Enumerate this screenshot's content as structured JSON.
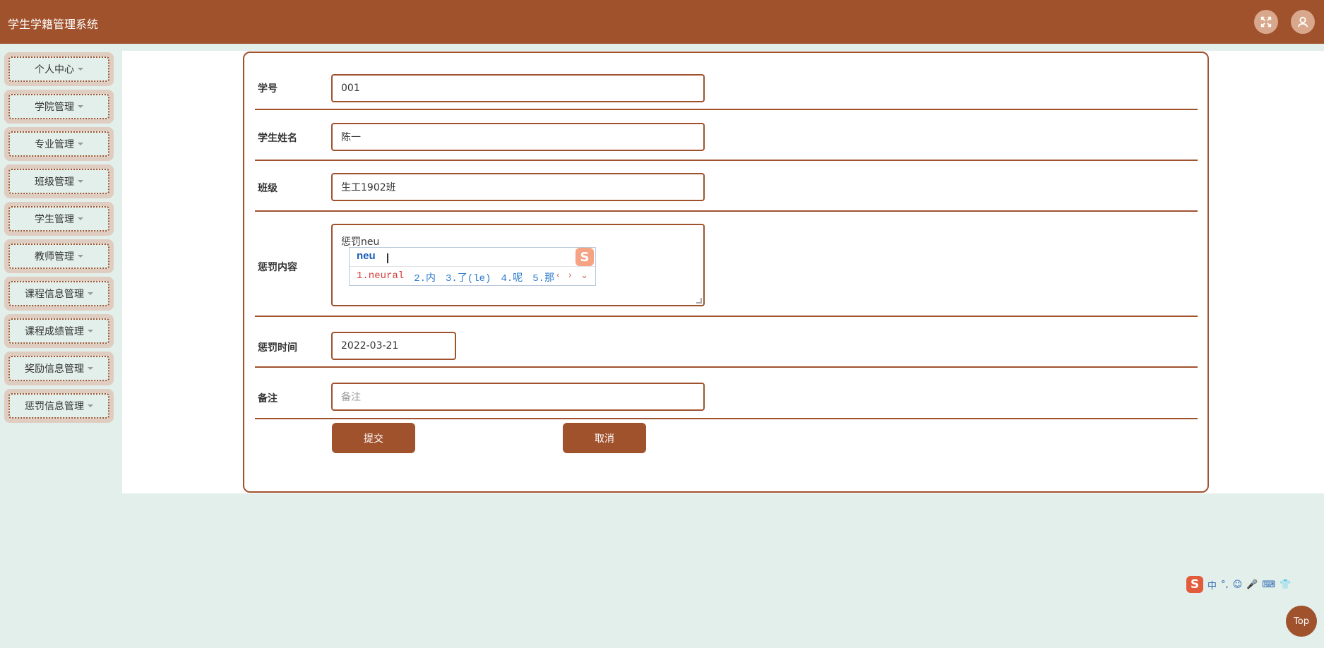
{
  "app": {
    "title": "学生学籍管理系统"
  },
  "header": {
    "fullscreen_icon": "fullscreen-icon",
    "user_icon": "user-icon"
  },
  "sidebar": {
    "items": [
      {
        "label": "个人中心"
      },
      {
        "label": "学院管理"
      },
      {
        "label": "专业管理"
      },
      {
        "label": "班级管理"
      },
      {
        "label": "学生管理"
      },
      {
        "label": "教师管理"
      },
      {
        "label": "课程信息管理"
      },
      {
        "label": "课程成绩管理"
      },
      {
        "label": "奖励信息管理"
      },
      {
        "label": "惩罚信息管理"
      }
    ]
  },
  "form": {
    "student_id": {
      "label": "学号",
      "value": "001"
    },
    "student_name": {
      "label": "学生姓名",
      "value": "陈一"
    },
    "class": {
      "label": "班级",
      "value": "生工1902班"
    },
    "punishment_content": {
      "label": "惩罚内容",
      "value": "惩罚neu"
    },
    "punishment_time": {
      "label": "惩罚时间",
      "value": "2022-03-21"
    },
    "remark": {
      "label": "备注",
      "placeholder": "备注"
    },
    "submit_label": "提交",
    "cancel_label": "取消"
  },
  "ime": {
    "composition": "neu",
    "candidates": [
      "1.neural",
      "2.内",
      "3.了(le)",
      "4.呢",
      "5.那"
    ],
    "logo": "S",
    "nav": "‹ › ⌄"
  },
  "ime_toolbar": {
    "logo": "S",
    "items": [
      "中",
      "°,",
      "☺",
      "🎤",
      "⌨",
      "👕"
    ]
  },
  "back_to_top": "Top",
  "colors": {
    "primary": "#a0522d",
    "background": "#e3efea"
  }
}
